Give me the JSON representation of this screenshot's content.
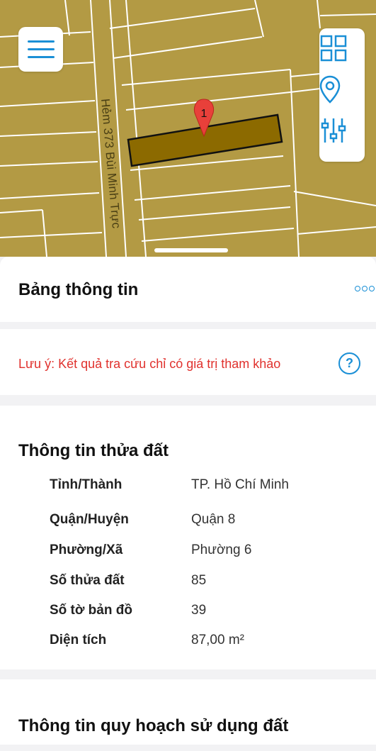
{
  "map": {
    "street_label": "Hẻm 373 Bùi Minh Trực",
    "marker_label": "1",
    "colors": {
      "land": "#b39a44",
      "road": "#ffffff",
      "parcel": "#8c6a00",
      "marker": "#e8403a"
    }
  },
  "toolbar": {
    "menu_icon": "hamburger-icon",
    "tools": [
      "grid-icon",
      "location-pin-icon",
      "sliders-icon"
    ]
  },
  "panel": {
    "title": "Bảng thông tin",
    "more_icon": "more-dots-icon"
  },
  "note": {
    "text": "Lưu ý: Kết quả tra cứu chỉ có giá trị tham khảo",
    "help_label": "?"
  },
  "parcel_info": {
    "title": "Thông tin thửa đất",
    "rows": [
      {
        "label": "Tỉnh/Thành",
        "value": "TP. Hồ Chí Minh"
      },
      {
        "label": "Quận/Huyện",
        "value": "Quận 8"
      },
      {
        "label": "Phường/Xã",
        "value": "Phường 6"
      },
      {
        "label": "Số thửa đất",
        "value": "85"
      },
      {
        "label": "Số tờ bản đồ",
        "value": "39"
      },
      {
        "label": "Diện tích",
        "value": "87,00 m²"
      }
    ]
  },
  "land_use": {
    "title": "Thông tin quy hoạch sử dụng đất"
  },
  "colors": {
    "accent": "#1a8fd6",
    "warning": "#e0312d"
  }
}
